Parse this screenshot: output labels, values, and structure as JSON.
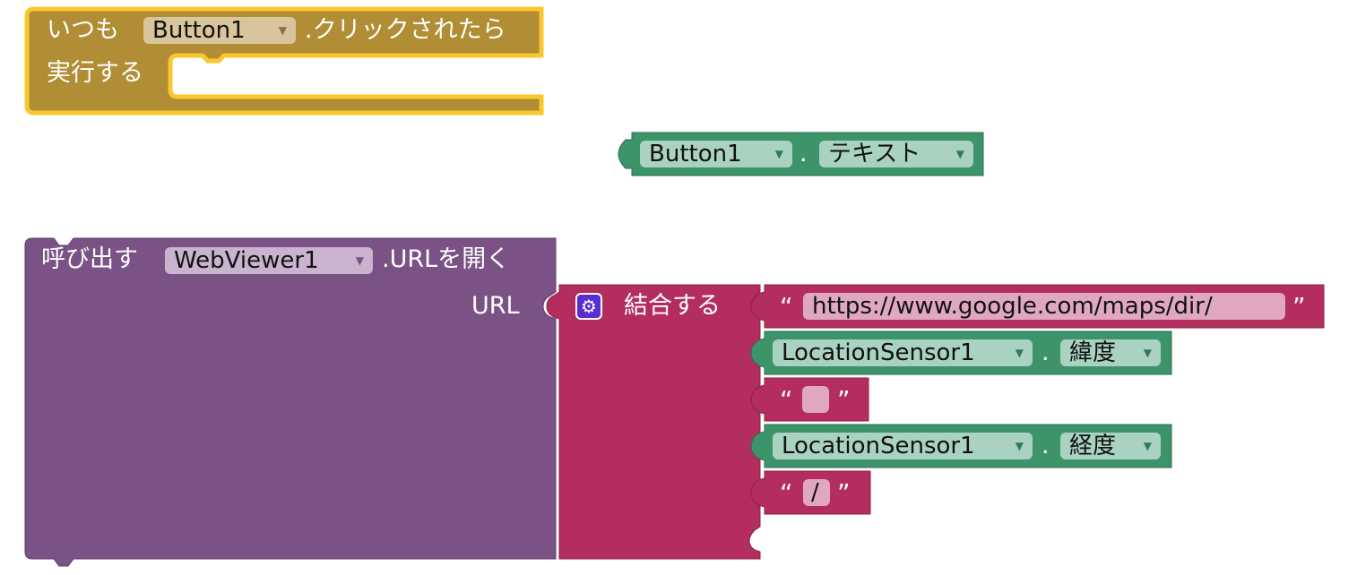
{
  "event_block": {
    "prefix": "いつも",
    "component": "Button1",
    "suffix": ".クリックされたら",
    "do_label": "実行する"
  },
  "getter_block": {
    "component": "Button1",
    "dot": ".",
    "property": "テキスト"
  },
  "call_block": {
    "prefix": "呼び出す",
    "component": "WebViewer1",
    "method": ".URLを開く",
    "arg_label": "URL"
  },
  "join_block": {
    "label": "結合する"
  },
  "join_items": [
    {
      "kind": "text",
      "value": "https://www.google.com/maps/dir/"
    },
    {
      "kind": "getter",
      "component": "LocationSensor1",
      "property": "緯度"
    },
    {
      "kind": "text",
      "value": ""
    },
    {
      "kind": "getter",
      "component": "LocationSensor1",
      "property": "経度"
    },
    {
      "kind": "text",
      "value": "/"
    }
  ],
  "symbols": {
    "dropdown_arrow": "▼",
    "dot": ".",
    "open_quote": "“",
    "close_quote": "”",
    "gear_icon": "⚙"
  },
  "colors": {
    "event_block": "#b18e35",
    "event_highlight": "#fbc72e",
    "component_getter": "#3d946b",
    "procedure_call": "#7b5286",
    "text_join": "#b32d5e"
  }
}
